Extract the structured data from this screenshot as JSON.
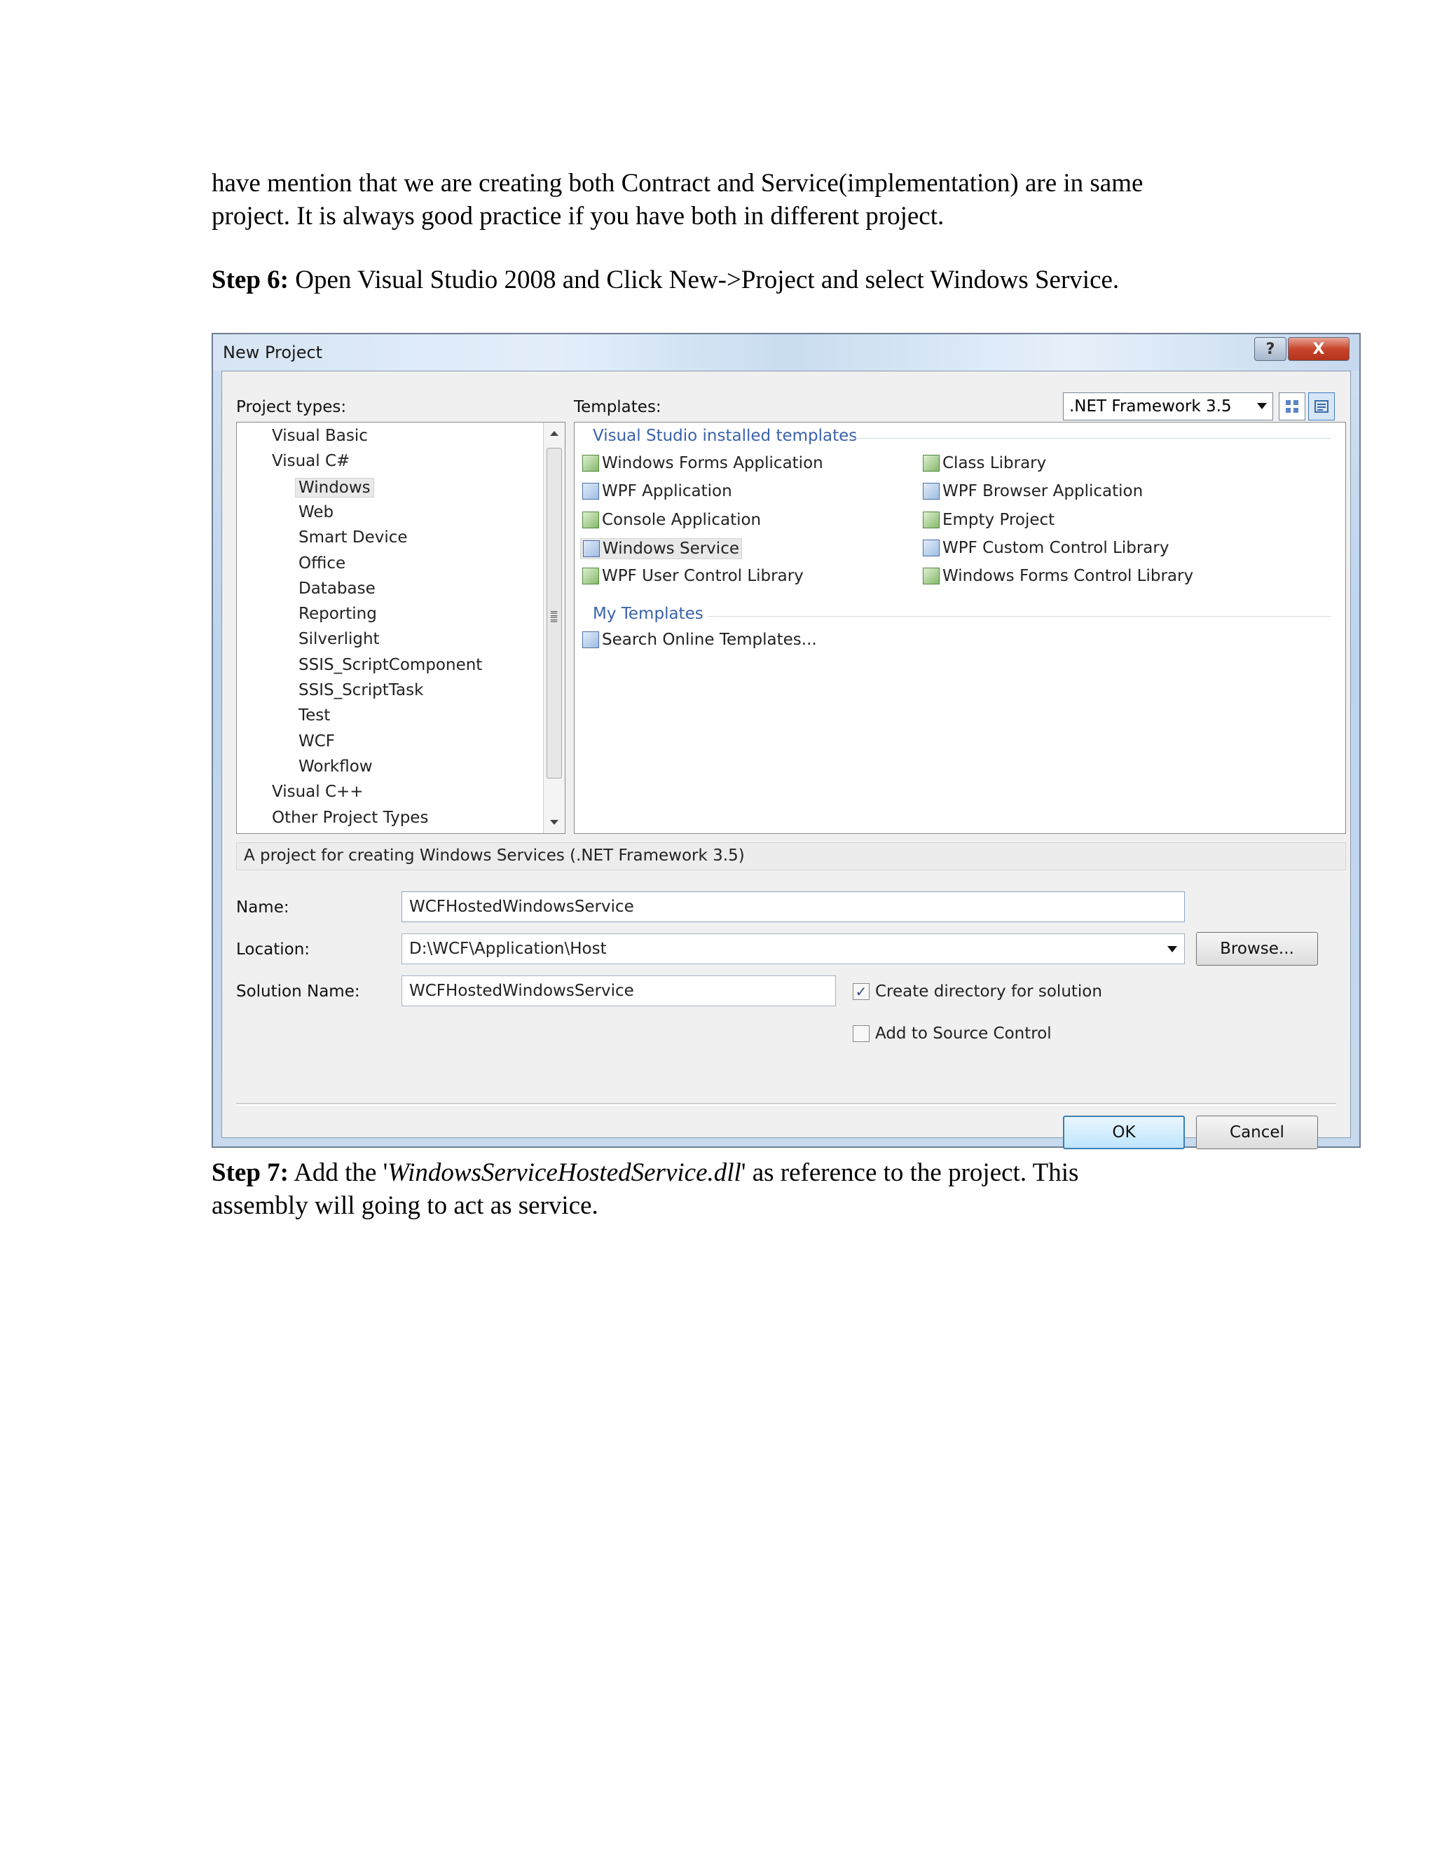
{
  "doc": {
    "intro_line1": "have mention that we are creating both Contract and Service(implementation) are in same",
    "intro_line2": "project. It is always good practice if you have both in different project.",
    "step6_label": "Step 6:",
    "step6_text": " Open Visual Studio 2008 and Click New->Project and select Windows Service.",
    "step7_label": "Step 7:",
    "step7_pre": " Add the '",
    "step7_italic": "WindowsServiceHostedService.dll",
    "step7_post": "' as reference to the project. This",
    "step7_line2": "assembly will going to act as service."
  },
  "dialog": {
    "title": "New Project",
    "help_glyph": "?",
    "close_glyph": "X",
    "project_types_label": "Project types:",
    "templates_label": "Templates:",
    "framework_selected": ".NET Framework 3.5",
    "project_types": [
      {
        "label": "Visual Basic",
        "level": 1
      },
      {
        "label": "Visual C#",
        "level": 1
      },
      {
        "label": "Windows",
        "level": 2,
        "selected": true
      },
      {
        "label": "Web",
        "level": 2
      },
      {
        "label": "Smart Device",
        "level": 2
      },
      {
        "label": "Office",
        "level": 2
      },
      {
        "label": "Database",
        "level": 2
      },
      {
        "label": "Reporting",
        "level": 2
      },
      {
        "label": "Silverlight",
        "level": 2
      },
      {
        "label": "SSIS_ScriptComponent",
        "level": 2
      },
      {
        "label": "SSIS_ScriptTask",
        "level": 2
      },
      {
        "label": "Test",
        "level": 2
      },
      {
        "label": "WCF",
        "level": 2
      },
      {
        "label": "Workflow",
        "level": 2
      },
      {
        "label": "Visual C++",
        "level": 1
      },
      {
        "label": "Other Project Types",
        "level": 1
      }
    ],
    "installed_group": "Visual Studio installed templates",
    "templates_left": [
      {
        "label": "Windows Forms Application",
        "icon": "windows-forms-icon"
      },
      {
        "label": "WPF Application",
        "icon": "wpf-app-icon"
      },
      {
        "label": "Console Application",
        "icon": "console-app-icon"
      },
      {
        "label": "Windows Service",
        "icon": "windows-service-icon",
        "selected": true
      },
      {
        "label": "WPF User Control Library",
        "icon": "wpf-user-control-icon"
      }
    ],
    "templates_right": [
      {
        "label": "Class Library",
        "icon": "class-library-icon"
      },
      {
        "label": "WPF Browser Application",
        "icon": "wpf-browser-icon"
      },
      {
        "label": "Empty Project",
        "icon": "empty-project-icon"
      },
      {
        "label": "WPF Custom Control Library",
        "icon": "wpf-custom-control-icon"
      },
      {
        "label": "Windows Forms Control Library",
        "icon": "forms-control-icon"
      }
    ],
    "my_templates_group": "My Templates",
    "search_online": "Search Online Templates...",
    "description": "A project for creating Windows Services (.NET Framework 3.5)",
    "name_label": "Name:",
    "name_value": "WCFHostedWindowsService",
    "location_label": "Location:",
    "location_value": "D:\\WCF\\Application\\Host",
    "solution_label": "Solution Name:",
    "solution_value": "WCFHostedWindowsService",
    "browse_label": "Browse...",
    "create_dir_label": "Create directory for solution",
    "create_dir_checked": true,
    "source_control_label": "Add to Source Control",
    "source_control_checked": false,
    "ok_label": "OK",
    "cancel_label": "Cancel"
  }
}
